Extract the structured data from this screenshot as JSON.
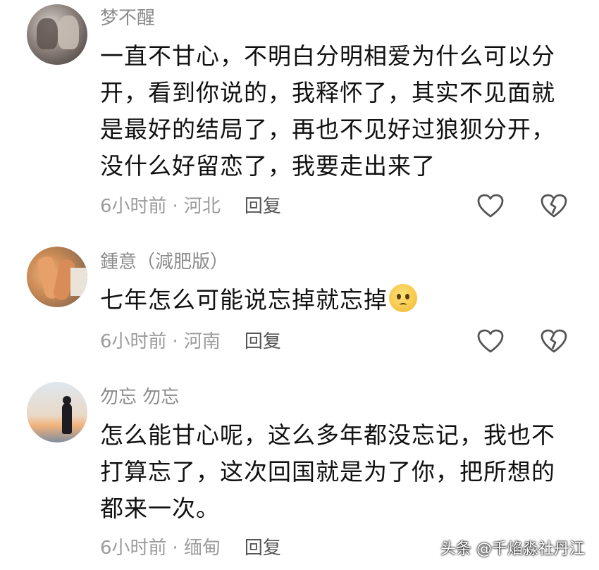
{
  "comments": [
    {
      "username": "梦不醒",
      "text": "一直不甘心，不明白分明相爱为什么可以分开，看到你说的，我释怀了，其实不见面就是最好的结局了，再也不见好过狼狈分开，没什么好留恋了，我要走出来了",
      "time": "6小时前",
      "location": "河北",
      "reply_label": "回复"
    },
    {
      "username": "鍾意（減肥版）",
      "text": "七年怎么可能说忘掉就忘掉",
      "emoji": "pleading-face",
      "time": "6小时前",
      "location": "河南",
      "reply_label": "回复"
    },
    {
      "username": "勿忘 勿忘",
      "text": "怎么能甘心呢，这么多年都没忘记，我也不打算忘了，这次回国就是为了你，把所想的都来一次。",
      "time": "6小时前",
      "location": "缅甸",
      "reply_label": "回复"
    }
  ],
  "separator": "·",
  "icons": {
    "like": "heart-outline-icon",
    "dislike": "broken-heart-icon"
  },
  "watermark": "头条 @千焰淼社丹江"
}
